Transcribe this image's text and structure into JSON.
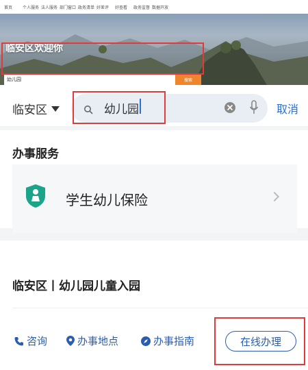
{
  "topnav": {
    "items": [
      "首页",
      "个人服务",
      "法人服务",
      "部门窗口",
      "政务清单",
      "好差评",
      "好查看",
      "政务监督",
      "数据开放"
    ]
  },
  "hero": {
    "title": "临安区欢迎你",
    "search_value": "幼儿园",
    "search_button": "搜索"
  },
  "search": {
    "region": "临安区",
    "query": "幼儿园",
    "cancel_label": "取消"
  },
  "services": {
    "title": "办事服务",
    "items": [
      {
        "label": "学生幼儿保险",
        "icon": "shield-child-icon"
      }
    ]
  },
  "result": {
    "title": "临安区丨幼儿园儿童入园",
    "actions": [
      {
        "label": "咨询",
        "icon": "phone-icon"
      },
      {
        "label": "办事地点",
        "icon": "location-pin-icon"
      },
      {
        "label": "办事指南",
        "icon": "compass-icon"
      }
    ],
    "online_button": "在线办理"
  },
  "colors": {
    "accent": "#2a5db0",
    "highlight": "#e03a3a",
    "hero_button": "#f0862b"
  }
}
